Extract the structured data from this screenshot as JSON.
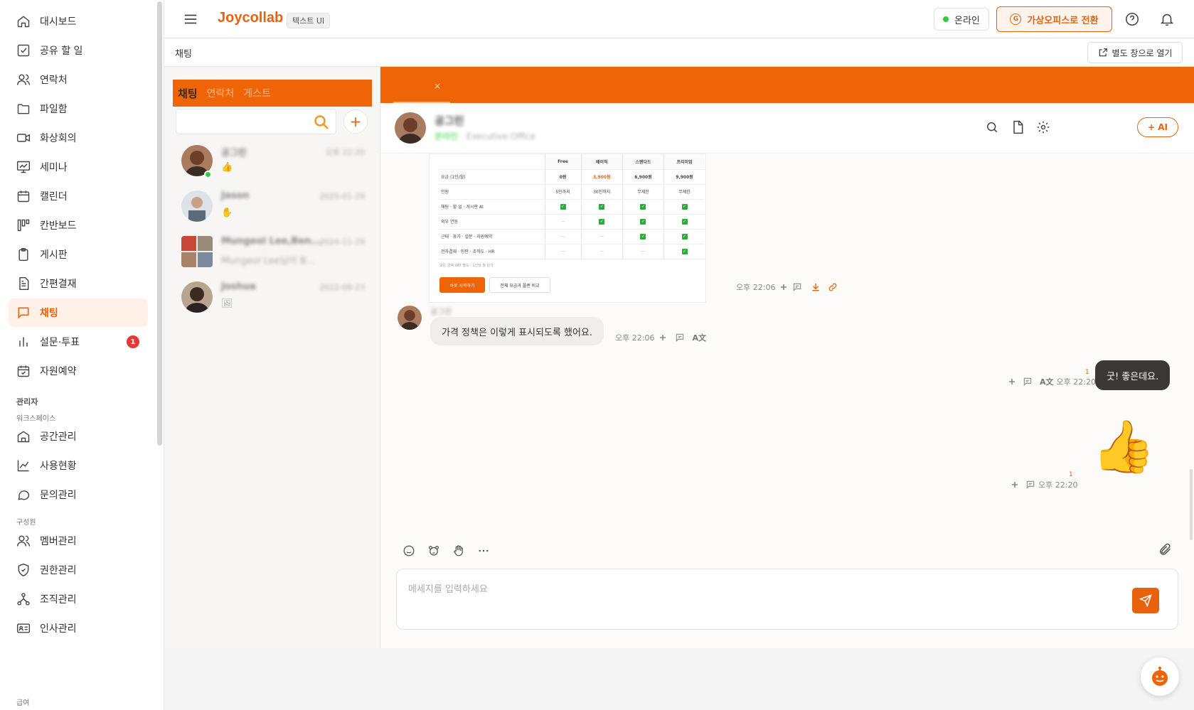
{
  "sidebar": {
    "items": [
      {
        "label": "대시보드",
        "icon": "home-icon"
      },
      {
        "label": "공유 할 일",
        "icon": "checkbox-icon"
      },
      {
        "label": "연락처",
        "icon": "people-icon"
      },
      {
        "label": "파일함",
        "icon": "folder-icon"
      },
      {
        "label": "화상회의",
        "icon": "video-icon"
      },
      {
        "label": "세미나",
        "icon": "presentation-icon"
      },
      {
        "label": "캘린더",
        "icon": "calendar-icon"
      },
      {
        "label": "칸반보드",
        "icon": "kanban-icon"
      },
      {
        "label": "게시판",
        "icon": "clipboard-icon"
      },
      {
        "label": "간편결재",
        "icon": "document-icon"
      },
      {
        "label": "채팅",
        "icon": "chat-icon",
        "active": true
      },
      {
        "label": "설문·투표",
        "icon": "bar-chart-icon",
        "badge": "1"
      },
      {
        "label": "자원예약",
        "icon": "calendar-check-icon"
      }
    ],
    "admin_section": "관리자",
    "workspace_sub": "워크스페이스",
    "admin_items": [
      {
        "label": "공간관리",
        "icon": "building-icon"
      },
      {
        "label": "사용현황",
        "icon": "line-chart-icon"
      },
      {
        "label": "문의관리",
        "icon": "message-circle-icon"
      }
    ],
    "members_sub": "구성원",
    "member_items": [
      {
        "label": "멤버관리",
        "icon": "people-icon"
      },
      {
        "label": "권한관리",
        "icon": "shield-icon"
      },
      {
        "label": "조직관리",
        "icon": "org-icon"
      },
      {
        "label": "인사관리",
        "icon": "id-card-icon"
      }
    ],
    "pay_sub": "급여"
  },
  "topbar": {
    "brand": "Joycollab",
    "brand_tag": "텍스트 UI",
    "status": "온라인",
    "virtual_office": "가상오피스로 전환",
    "virtual_office_badge": "G"
  },
  "subheader": {
    "title": "채팅",
    "open_window": "별도 창으로 열기"
  },
  "chat_list": {
    "tabs": [
      "채팅",
      "연락처",
      "게스트"
    ],
    "conversations": [
      {
        "name": "공그린",
        "time": "오후 22:20",
        "preview": "👍"
      },
      {
        "name": "Jason",
        "time": "2025-01-29",
        "preview": "✋"
      },
      {
        "name": "Mungeol Lee,Ben...",
        "time": "2024-11-29",
        "preview": "Mungeol Lee님이 B..."
      },
      {
        "name": "Joshua",
        "time": "2022-08-23",
        "preview": "🖼"
      }
    ]
  },
  "chat": {
    "close_x": "×",
    "partner_name": "공그린",
    "partner_status": "온라인",
    "partner_dept": "· Executive Office",
    "ai_button": "+ AI",
    "pricing_image": {
      "headers": [
        "",
        "Free",
        "베이직",
        "스탠다드",
        "프리미엄"
      ],
      "rows": [
        [
          "요금 (1인/월)",
          "0원",
          "3,900원",
          "6,900원",
          "9,900원"
        ],
        [
          "인원",
          "5인까지",
          "30인까지",
          "무제한",
          "무제한"
        ],
        [
          "채팅 · 할 일 · 게시판 AI",
          "✓",
          "✓",
          "✓",
          "✓"
        ],
        [
          "외부 연동",
          "—",
          "✓",
          "✓",
          "✓"
        ],
        [
          "근태 · 휴가 · 설문 · 자원예약",
          "—",
          "—",
          "✓",
          "✓"
        ],
        [
          "전자결재 · 인판 · 조직도 · HR",
          "—",
          "—",
          "—",
          "✓"
        ]
      ],
      "note": "모든 금액 VAT 별도 · 1인당 월 단가",
      "start_button": "바로 시작하기",
      "compare_button": "전체 요금과 플랜 비교"
    },
    "msg1_time": "오후 22:06",
    "msg2_name": "공그린",
    "msg2_text": "가격 정책은 이렇게 표시되도록 했어요.",
    "msg2_time": "오후 22:06",
    "msg2_translate": "A文",
    "msg3_text": "굿! 좋은데요.",
    "msg3_time": "오후 22:20",
    "msg3_unread": "1",
    "msg3_translate": "A文",
    "msg4_emoji": "👍",
    "msg4_time": "오후 22:20",
    "msg4_unread": "1",
    "composer_placeholder": "메세지를 입력하세요"
  },
  "colors": {
    "accent": "#e8620c",
    "tab_bar": "#ef6406",
    "online": "#2ecc40",
    "badge": "#e53935"
  }
}
